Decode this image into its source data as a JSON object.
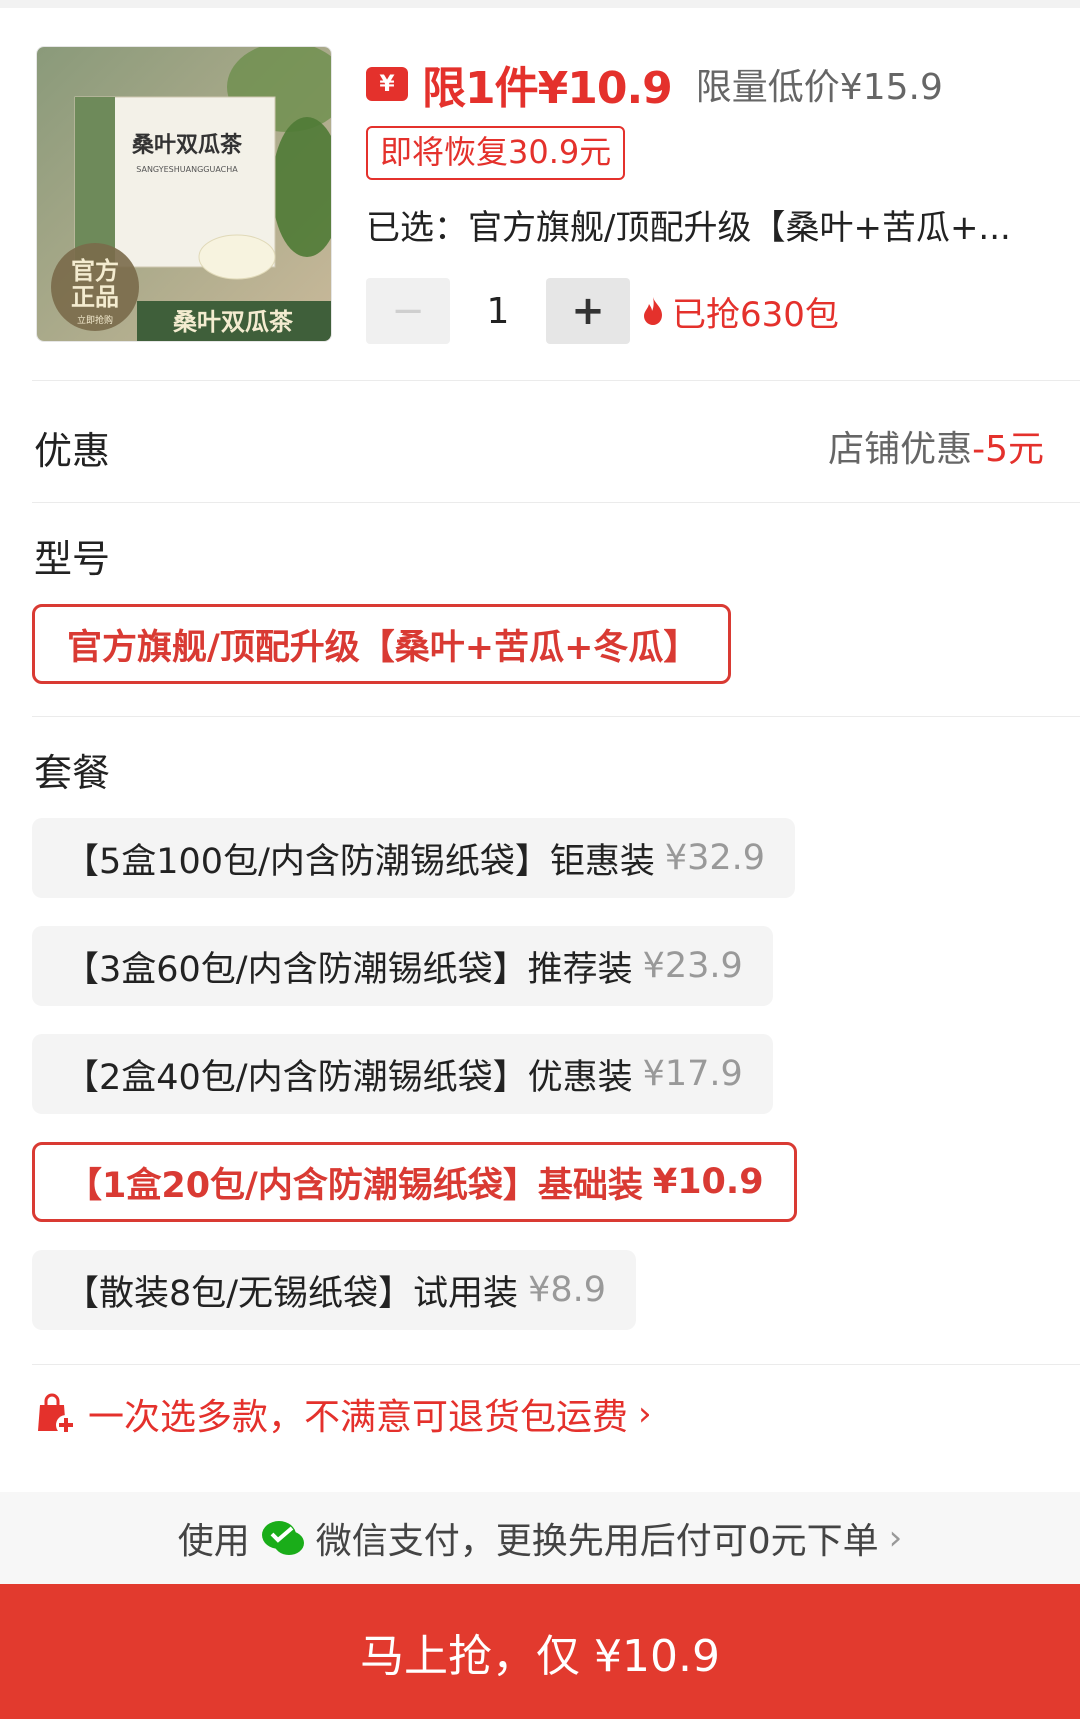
{
  "product": {
    "coupon_icon_text": "¥",
    "price_main": "限1件¥10.9",
    "price_limited": "限量低价¥15.9",
    "restore_notice": "即将恢复30.9元",
    "selected_text": "已选：官方旗舰/顶配升级【桑叶+苦瓜+...",
    "quantity": "1",
    "minus_symbol": "−",
    "plus_symbol": "+",
    "sold_text": "已抢630包",
    "image": {
      "box_title": "桑叶双瓜茶",
      "box_subtitle": "SANGYESHUANGGUACHA",
      "badge_line1": "官方",
      "badge_line2": "正品",
      "badge_small": "立即抢购",
      "bottom_title": "桑叶双瓜茶"
    }
  },
  "discount": {
    "label": "优惠",
    "value_prefix": "店铺优惠",
    "value_amount": "-5元"
  },
  "model": {
    "label": "型号",
    "options": [
      {
        "label": "官方旗舰/顶配升级【桑叶+苦瓜+冬瓜】",
        "selected": true
      }
    ]
  },
  "package": {
    "label": "套餐",
    "options": [
      {
        "label": "【5盒100包/内含防潮锡纸袋】钜惠装",
        "price": "¥32.9",
        "selected": false
      },
      {
        "label": "【3盒60包/内含防潮锡纸袋】推荐装",
        "price": "¥23.9",
        "selected": false
      },
      {
        "label": "【2盒40包/内含防潮锡纸袋】优惠装",
        "price": "¥17.9",
        "selected": false
      },
      {
        "label": "【1盒20包/内含防潮锡纸袋】基础装",
        "price": "¥10.9",
        "selected": true
      },
      {
        "label": "【散装8包/无锡纸袋】试用装",
        "price": "¥8.9",
        "selected": false
      }
    ]
  },
  "promo": {
    "text": "一次选多款，不满意可退货包运费",
    "chevron": "›"
  },
  "payment_band": {
    "prefix": "使用",
    "text": "微信支付，更换先用后付可0元下单",
    "chevron": "›"
  },
  "buy_button": {
    "label": "马上抢，仅 ¥10.9"
  },
  "colors": {
    "accent_red": "#e4312c",
    "wechat_green": "#1aad19"
  },
  "icons": [
    "coupon-icon",
    "fire-icon",
    "shopping-bag-plus-icon",
    "wechat-icon",
    "chevron-right-icon"
  ]
}
